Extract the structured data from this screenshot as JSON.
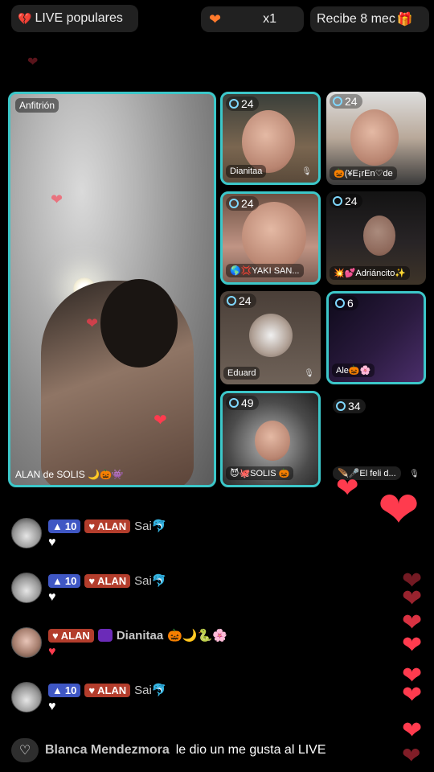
{
  "top_bar": {
    "live_label": "LIVE populares",
    "gift_count": "x1",
    "recibe_label": "Recibe 8 mec"
  },
  "host": {
    "role_label": "Anfitrión",
    "name": "ALAN de SOLIS 🌙🎃👾"
  },
  "guests": [
    {
      "viewers": "24",
      "name": "Dianitaa"
    },
    {
      "viewers": "24",
      "name": "🎃(¥E¡rEn♡de"
    },
    {
      "viewers": "24",
      "name": "🌎💢YAKI SAN..."
    },
    {
      "viewers": "24",
      "name": "💥💕Adriáncito✨"
    },
    {
      "viewers": "24",
      "name": "Eduard"
    },
    {
      "viewers": "6",
      "name": "Ale🎃🌸"
    },
    {
      "viewers": "49",
      "name": "😈🐙SOLIS 🎃"
    },
    {
      "viewers": "34",
      "name": "🪶🎤El feli d..."
    }
  ],
  "comments": [
    {
      "level": "10",
      "fan_badge": "ALAN",
      "text": "Sai🐬",
      "heart": "white"
    },
    {
      "level": "10",
      "fan_badge": "ALAN",
      "text": "Sai🐬",
      "heart": "white"
    },
    {
      "fan_badge": "ALAN",
      "name": "Dianitaa",
      "text": "🎃🌙🐍🌸",
      "heart": "red"
    },
    {
      "level": "10",
      "fan_badge": "ALAN",
      "text": "Sai🐬",
      "heart": "white"
    }
  ],
  "footer": {
    "user": "Blanca Mendezmora",
    "action": "le dio un me gusta al LIVE"
  },
  "colors": {
    "accent": "#3cc7c9",
    "heart": "#ff3b4e",
    "level_badge": "#3f57c4",
    "fan_badge": "#b33d2c"
  }
}
